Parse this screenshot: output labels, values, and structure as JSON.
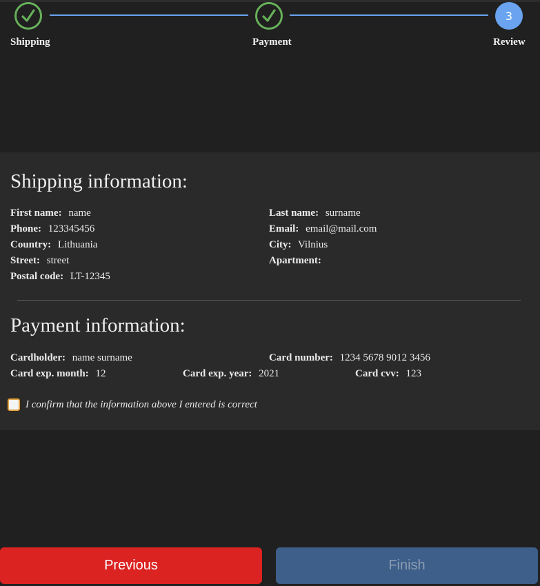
{
  "stepper": {
    "steps": [
      {
        "label": "Shipping",
        "state": "done",
        "icon": "check-icon"
      },
      {
        "label": "Payment",
        "state": "done",
        "icon": "check-icon"
      },
      {
        "label": "Review",
        "state": "active",
        "number": "3"
      }
    ],
    "colors": {
      "done": "#67b05a",
      "active": "#6aa4f0",
      "line": "#6aa4f0"
    }
  },
  "shipping": {
    "title": "Shipping information:",
    "first_name": {
      "label": "First name:",
      "value": "name"
    },
    "last_name": {
      "label": "Last name:",
      "value": "surname"
    },
    "phone": {
      "label": "Phone:",
      "value": "123345456"
    },
    "email": {
      "label": "Email:",
      "value": "email@mail.com"
    },
    "country": {
      "label": "Country:",
      "value": "Lithuania"
    },
    "city": {
      "label": "City:",
      "value": "Vilnius"
    },
    "street": {
      "label": "Street:",
      "value": "street"
    },
    "apartment": {
      "label": "Apartment:",
      "value": ""
    },
    "postal_code": {
      "label": "Postal code:",
      "value": "LT-12345"
    }
  },
  "payment": {
    "title": "Payment information:",
    "cardholder": {
      "label": "Cardholder:",
      "value": "name surname"
    },
    "card_number": {
      "label": "Card number:",
      "value": "1234 5678 9012 3456"
    },
    "exp_month": {
      "label": "Card exp. month:",
      "value": "12"
    },
    "exp_year": {
      "label": "Card exp. year:",
      "value": "2021"
    },
    "cvv": {
      "label": "Card cvv:",
      "value": "123"
    }
  },
  "confirm": {
    "text": "I confirm that the information above I entered is correct",
    "checked": false
  },
  "buttons": {
    "previous": "Previous",
    "finish": "Finish",
    "previous_color": "#db2322",
    "finish_color": "#3d5f89"
  }
}
